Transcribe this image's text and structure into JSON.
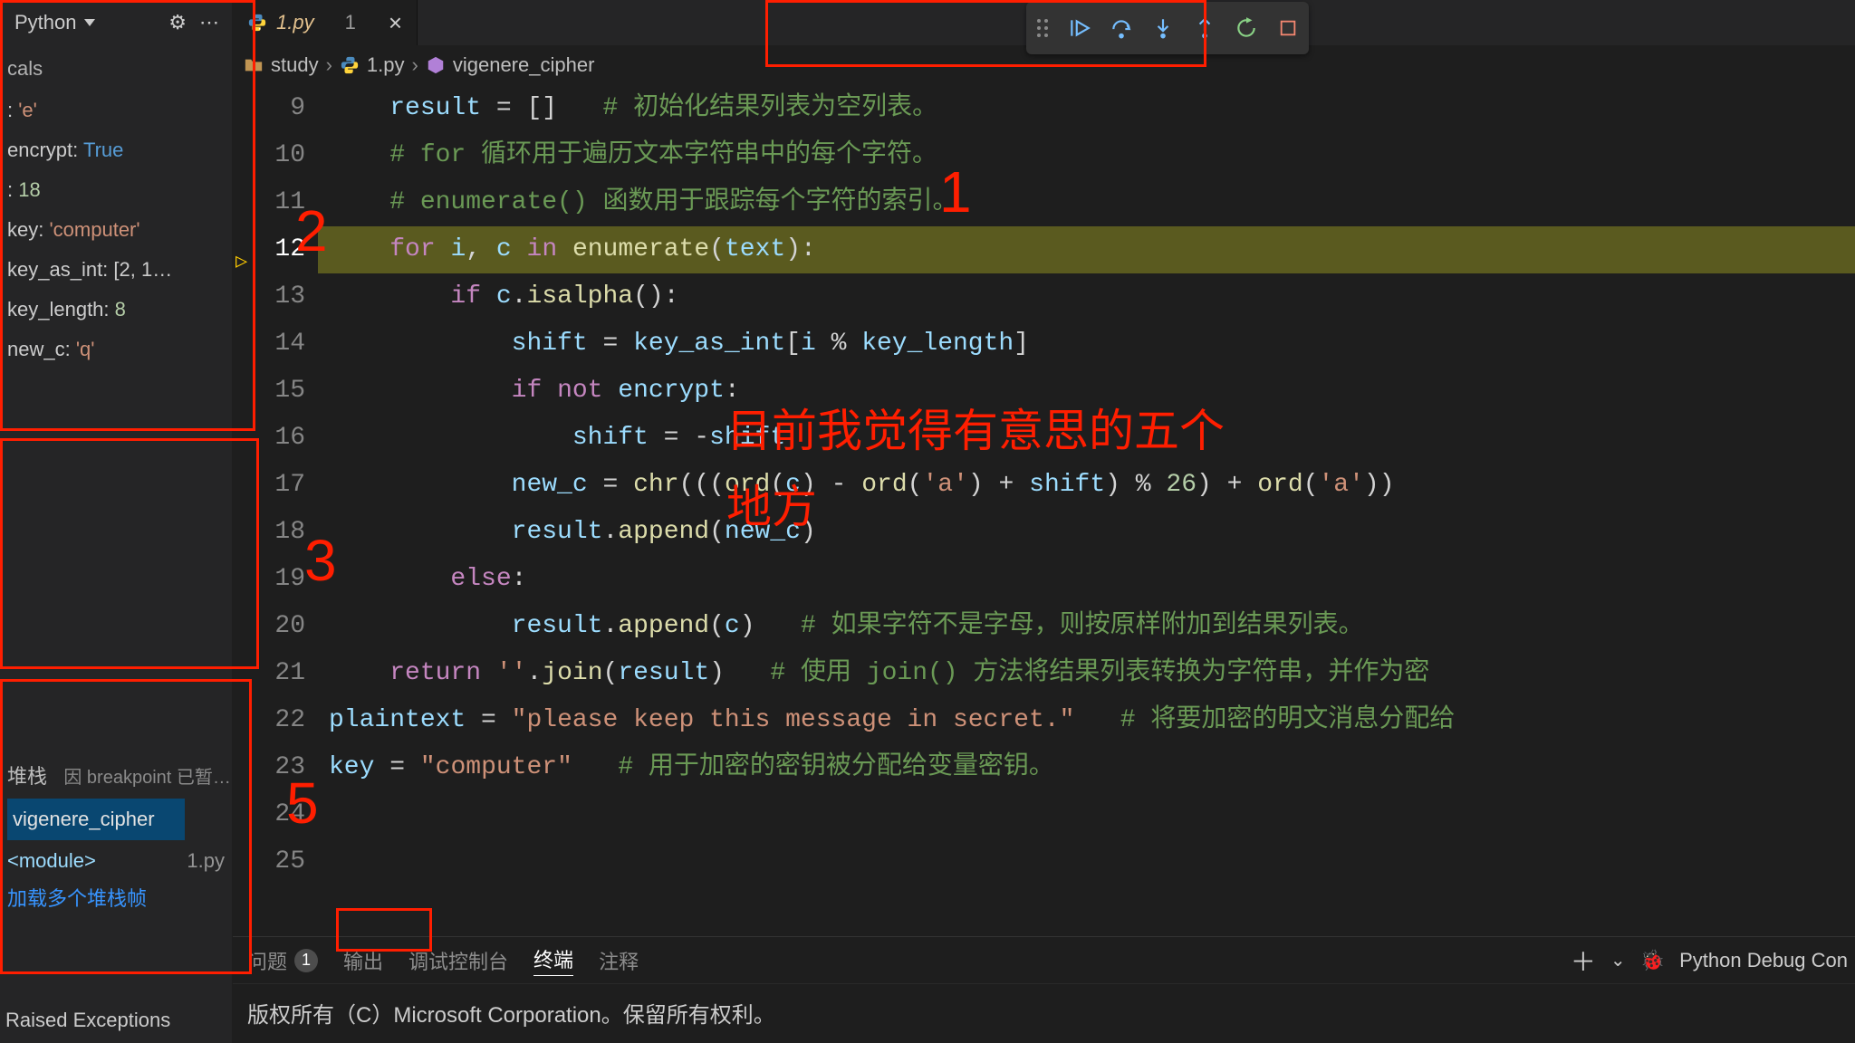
{
  "sidebar": {
    "debuggerName": "Python",
    "localsTitle": "cals",
    "locals": [
      {
        "name": "",
        "suffix": ":",
        "value": "'e'",
        "valueClass": "tok-key"
      },
      {
        "name": "encrypt",
        "suffix": ":",
        "value": "True",
        "valueClass": "tok-bool"
      },
      {
        "name": "",
        "suffix": ":",
        "value": "18",
        "valueClass": "tok-num"
      },
      {
        "name": "key",
        "suffix": ":",
        "value": "'computer'",
        "valueClass": "tok-key"
      },
      {
        "name": "key_as_int",
        "suffix": ":",
        "value": "[2, 1…",
        "valueClass": "tok-varname"
      },
      {
        "name": "key_length",
        "suffix": ":",
        "value": "8",
        "valueClass": "tok-num"
      },
      {
        "name": "new_c",
        "suffix": ":",
        "value": "'q'",
        "valueClass": "tok-key"
      }
    ],
    "callstackTitle": "堆栈",
    "callstackStatus": "因 breakpoint 已暂…",
    "callstackFunc": "vigenere_cipher",
    "callstackModule": "<module>",
    "callstackFile": "1.py",
    "callstackLoadMore": "加载多个堆栈帧",
    "raisedExceptions": "Raised Exceptions"
  },
  "tab": {
    "filename": "1.py",
    "count": "1"
  },
  "breadcrumbs": {
    "folder": "study",
    "file": "1.py",
    "symbol": "vigenere_cipher"
  },
  "debugToolbar": {
    "continue": "continue",
    "stepOver": "step-over",
    "stepInto": "step-into",
    "stepOut": "step-out",
    "restart": "restart",
    "stop": "stop"
  },
  "code": {
    "startLine": 9,
    "currentLine": 12,
    "lines": [
      {
        "n": 9,
        "indent": 1,
        "html": "<span class='tok-var'>result</span> <span class='tok-op'>=</span> <span class='tok-pun'>[]</span>   <span class='tok-comment'># 初始化结果列表为空列表。</span>"
      },
      {
        "n": 10,
        "indent": 1,
        "html": "<span class='tok-comment'># for 循环用于遍历文本字符串中的每个字符。</span>"
      },
      {
        "n": 11,
        "indent": 1,
        "html": "<span class='tok-comment'># enumerate() 函数用于跟踪每个字符的索引。</span>"
      },
      {
        "n": 12,
        "indent": 1,
        "html": "<span class='tok-kw'>for</span> <span class='tok-var'>i</span><span class='tok-pun'>,</span> <span class='tok-var'>c</span> <span class='tok-kw'>in</span> <span class='tok-fn'>enumerate</span><span class='tok-pun'>(</span><span class='tok-var'>text</span><span class='tok-pun'>):</span>"
      },
      {
        "n": 13,
        "indent": 2,
        "html": "<span class='tok-kw'>if</span> <span class='tok-var'>c</span><span class='tok-pun'>.</span><span class='tok-fn'>isalpha</span><span class='tok-pun'>():</span>"
      },
      {
        "n": 14,
        "indent": 3,
        "html": "<span class='tok-var'>shift</span> <span class='tok-op'>=</span> <span class='tok-var'>key_as_int</span><span class='tok-pun'>[</span><span class='tok-var'>i</span> <span class='tok-op'>%</span> <span class='tok-var'>key_length</span><span class='tok-pun'>]</span>"
      },
      {
        "n": 15,
        "indent": 3,
        "html": "<span class='tok-kw'>if</span> <span class='tok-kw'>not</span> <span class='tok-var'>encrypt</span><span class='tok-pun'>:</span>"
      },
      {
        "n": 16,
        "indent": 4,
        "html": "<span class='tok-var'>shift</span> <span class='tok-op'>=</span> <span class='tok-op'>-</span><span class='tok-var'>shift</span>"
      },
      {
        "n": 17,
        "indent": 3,
        "html": "<span class='tok-var'>new_c</span> <span class='tok-op'>=</span> <span class='tok-fn'>chr</span><span class='tok-pun'>(((</span><span class='tok-fn'>ord</span><span class='tok-pun'>(</span><span class='tok-var'>c</span><span class='tok-pun'>)</span> <span class='tok-op'>-</span> <span class='tok-fn'>ord</span><span class='tok-pun'>(</span><span class='tok-str'>'a'</span><span class='tok-pun'>)</span> <span class='tok-op'>+</span> <span class='tok-var'>shift</span><span class='tok-pun'>)</span> <span class='tok-op'>%</span> <span class='tok-numc'>26</span><span class='tok-pun'>)</span> <span class='tok-op'>+</span> <span class='tok-fn'>ord</span><span class='tok-pun'>(</span><span class='tok-str'>'a'</span><span class='tok-pun'>))</span>"
      },
      {
        "n": 18,
        "indent": 3,
        "html": "<span class='tok-var'>result</span><span class='tok-pun'>.</span><span class='tok-fn'>append</span><span class='tok-pun'>(</span><span class='tok-var'>new_c</span><span class='tok-pun'>)</span>"
      },
      {
        "n": 19,
        "indent": 2,
        "html": "<span class='tok-kw'>else</span><span class='tok-pun'>:</span>"
      },
      {
        "n": 20,
        "indent": 3,
        "html": "<span class='tok-var'>result</span><span class='tok-pun'>.</span><span class='tok-fn'>append</span><span class='tok-pun'>(</span><span class='tok-var'>c</span><span class='tok-pun'>)</span>   <span class='tok-comment'># 如果字符不是字母，则按原样附加到结果列表。</span>"
      },
      {
        "n": 21,
        "indent": 1,
        "html": "<span class='tok-kw'>return</span> <span class='tok-str'>''</span><span class='tok-pun'>.</span><span class='tok-fn'>join</span><span class='tok-pun'>(</span><span class='tok-var'>result</span><span class='tok-pun'>)</span>   <span class='tok-comment'># 使用 join() 方法将结果列表转换为字符串，并作为密</span>"
      },
      {
        "n": 22,
        "indent": 0,
        "html": ""
      },
      {
        "n": 23,
        "indent": 0,
        "html": ""
      },
      {
        "n": 24,
        "indent": 0,
        "html": "<span class='tok-var'>plaintext</span> <span class='tok-op'>=</span> <span class='tok-str'>\"please keep this message in secret.\"</span>   <span class='tok-comment'># 将要加密的明文消息分配给</span>"
      },
      {
        "n": 25,
        "indent": 0,
        "html": "<span class='tok-var'>key</span> <span class='tok-op'>=</span> <span class='tok-str'>\"computer\"</span>   <span class='tok-comment'># 用于加密的密钥被分配给变量密钥。</span>"
      }
    ]
  },
  "panel": {
    "tabs": {
      "problems": "问题",
      "problemsCount": "1",
      "output": "输出",
      "debugConsole": "调试控制台",
      "terminal": "终端",
      "comments": "注释"
    },
    "right": {
      "debugLabel": "Python Debug Con"
    },
    "body": "版权所有（C）Microsoft Corporation。保留所有权利。"
  },
  "annotations": {
    "n1": "1",
    "n2": "2",
    "n3": "3",
    "n5": "5",
    "textLine1": "目前我觉得有意思的五个",
    "textLine2": "地方"
  }
}
